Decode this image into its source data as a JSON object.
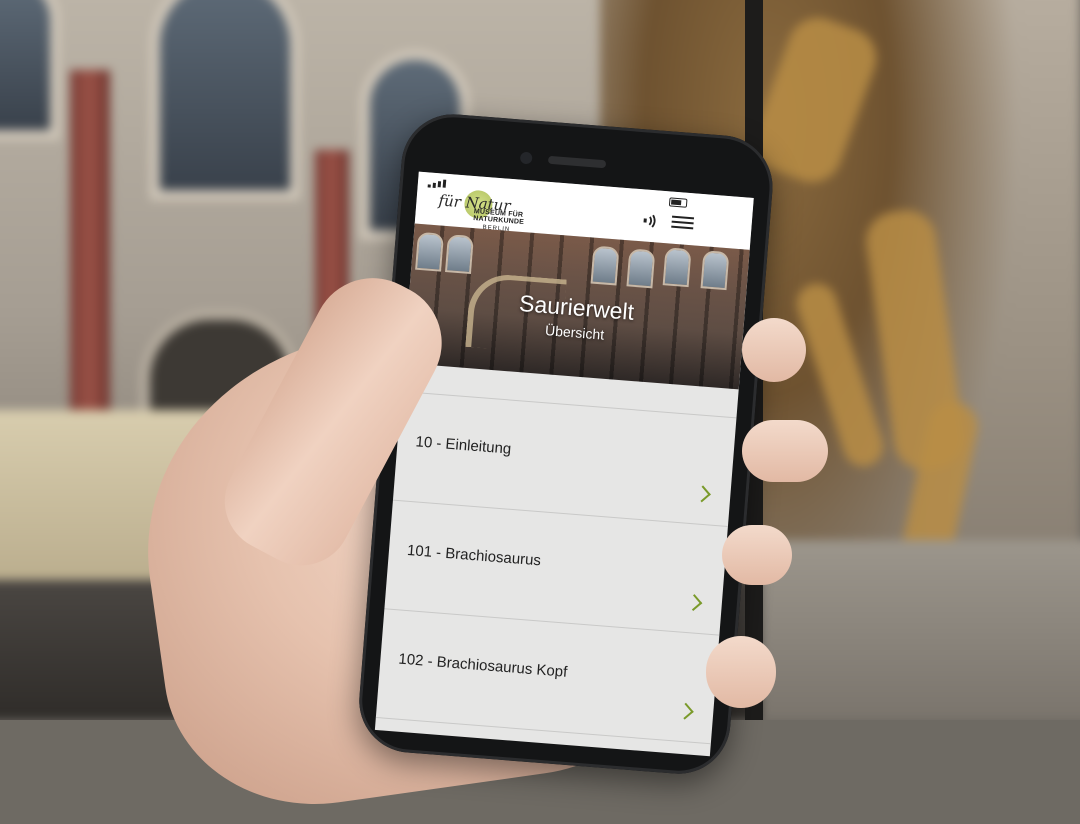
{
  "app": {
    "logo_script": "für Natur",
    "logo_name": "MUSEUM FÜR NATURKUNDE",
    "logo_city": "BERLIN",
    "accent_color": "#7a9a2a"
  },
  "header": {
    "audio_icon": "audio-guide-icon",
    "menu_icon": "hamburger-menu-icon"
  },
  "hero": {
    "title": "Saurierwelt",
    "subtitle": "Übersicht"
  },
  "list": {
    "items": [
      {
        "label": "10 - Einleitung"
      },
      {
        "label": "101 - Brachiosaurus"
      },
      {
        "label": "102 - Brachiosaurus Kopf"
      }
    ]
  }
}
